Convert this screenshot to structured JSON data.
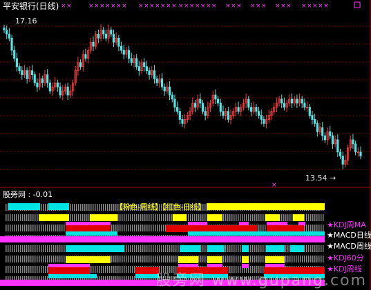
{
  "window": {
    "title": "平安银行(日线)",
    "sub_title": "股旁网 : -0.01",
    "legend": "【粉色-周线】【红色-日线】【黄色-60分钟线】【青色-30分钟线】",
    "watermark": "股旁网 www.gupang.com"
  },
  "colors": {
    "background": "#000000",
    "up": "#ff3c3c",
    "down": "#54e4e4",
    "grid": "#8b0000",
    "pink": "#ff32ff",
    "red": "#e00000",
    "yellow": "#ffff00",
    "cyan": "#00e4e4",
    "white": "#ffffff"
  },
  "indicator_labels": [
    {
      "text": "KDJ周MA",
      "color": "#ff32ff"
    },
    {
      "text": "MACD日线",
      "color": "#ffffff"
    },
    {
      "text": "MACD周线",
      "color": "#ffffff"
    },
    {
      "text": "KDJ60分",
      "color": "#ff32ff"
    },
    {
      "text": "KDJ周线",
      "color": "#ff32ff"
    }
  ],
  "chart_data": {
    "type": "candlestick",
    "title": "平安银行(日线)",
    "high_label": "17.16",
    "low_label": "13.54",
    "high": 17.16,
    "low": 13.54,
    "y_range": [
      13.2,
      17.4
    ],
    "close_series": [
      16.9,
      16.8,
      16.7,
      16.4,
      16.2,
      16.0,
      15.9,
      15.8,
      15.9,
      15.7,
      15.9,
      15.8,
      15.6,
      15.5,
      15.7,
      15.6,
      15.8,
      15.6,
      15.4,
      15.5,
      15.6,
      15.5,
      15.3,
      15.4,
      15.5,
      15.3,
      15.4,
      15.6,
      15.9,
      16.1,
      16.0,
      16.3,
      16.2,
      16.4,
      16.6,
      16.5,
      16.8,
      16.7,
      16.9,
      16.8,
      16.7,
      16.9,
      16.8,
      16.6,
      16.7,
      16.5,
      16.4,
      16.3,
      16.4,
      16.2,
      16.1,
      16.2,
      16.0,
      15.9,
      16.1,
      16.0,
      15.9,
      15.8,
      15.9,
      15.7,
      15.6,
      15.7,
      15.5,
      15.4,
      15.5,
      15.3,
      15.2,
      15.0,
      14.9,
      14.7,
      14.6,
      14.7,
      14.8,
      14.9,
      15.1,
      15.0,
      15.2,
      15.1,
      14.9,
      14.8,
      15.0,
      15.1,
      15.3,
      15.2,
      15.1,
      14.9,
      14.8,
      14.9,
      14.7,
      14.8,
      14.9,
      15.0,
      14.9,
      15.0,
      15.1,
      15.2,
      15.0,
      14.9,
      15.0,
      14.9,
      14.8,
      14.7,
      14.6,
      14.7,
      14.8,
      14.9,
      15.0,
      15.1,
      15.2,
      15.1,
      15.0,
      15.1,
      15.2,
      15.1,
      15.2,
      15.1,
      15.2,
      15.1,
      15.0,
      15.0,
      14.8,
      14.7,
      14.6,
      14.4,
      14.5,
      14.3,
      14.2,
      14.4,
      14.3,
      14.1,
      14.2,
      13.9,
      13.8,
      13.6,
      13.7,
      14.0,
      14.2,
      14.1,
      13.9,
      13.9,
      13.8
    ]
  }
}
